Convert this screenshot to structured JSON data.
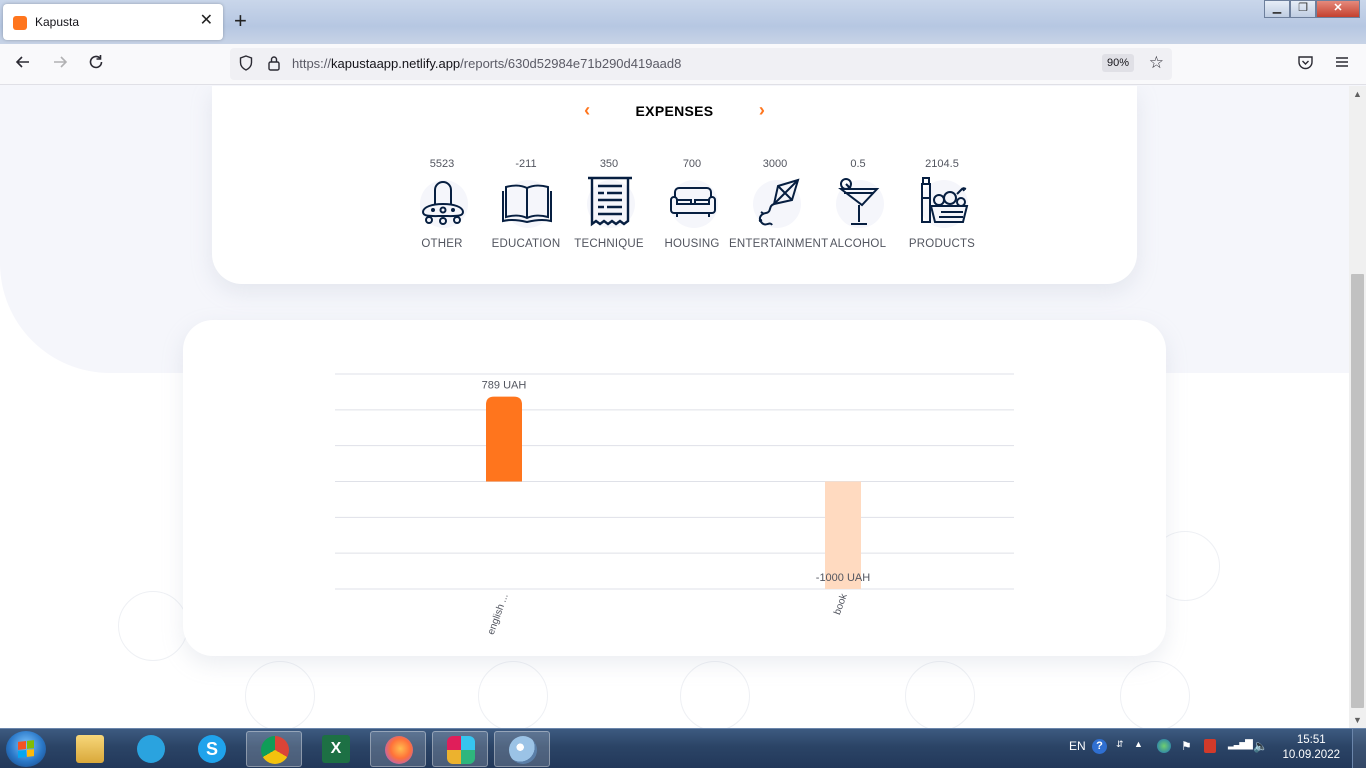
{
  "browser": {
    "tab_title": "Kapusta",
    "tab_close": "✕",
    "new_tab": "+",
    "window_controls": {
      "minimize": "▁",
      "restore": "❐",
      "close": "✕"
    },
    "url_scheme": "https://",
    "url_host": "kapustaapp.netlify.app",
    "url_path": "/reports/630d52984e71b290d419aad8",
    "zoom": "90%"
  },
  "colors": {
    "accent": "#ff751d",
    "accent_light": "#ffdac0",
    "card_bg": "#ffffff",
    "page_bg": "#f5f6fb",
    "text": "#52555f"
  },
  "switcher": {
    "prev_icon": "chevron-left-icon",
    "title": "EXPENSES",
    "next_icon": "chevron-right-icon"
  },
  "categories": [
    {
      "value": "5523",
      "label": "OTHER",
      "icon": "ufo-icon"
    },
    {
      "value": "-211",
      "label": "EDUCATION",
      "icon": "book-icon"
    },
    {
      "value": "350",
      "label": "TECHNIQUE",
      "icon": "receipt-icon"
    },
    {
      "value": "700",
      "label": "HOUSING",
      "icon": "sofa-icon"
    },
    {
      "value": "3000",
      "label": "ENTERTAINMENT",
      "icon": "kite-icon"
    },
    {
      "value": "0.5",
      "label": "ALCOHOL",
      "icon": "cocktail-icon"
    },
    {
      "value": "2104.5",
      "label": "PRODUCTS",
      "icon": "groceries-icon"
    }
  ],
  "chart_data": {
    "type": "bar",
    "categories": [
      "english ...",
      "book"
    ],
    "values": [
      789,
      -1000
    ],
    "data_labels": [
      "789 UAH",
      "-1000 UAH"
    ],
    "unit": "UAH",
    "ylim": [
      -1000,
      1000
    ],
    "grid": true,
    "colors": [
      "#ff751d",
      "#ffdac0"
    ]
  },
  "taskbar": {
    "apps": [
      "file-explorer",
      "telegram",
      "skype",
      "chrome",
      "excel",
      "firefox",
      "slack",
      "paint"
    ],
    "language": "EN",
    "time": "15:51",
    "date": "10.09.2022"
  }
}
